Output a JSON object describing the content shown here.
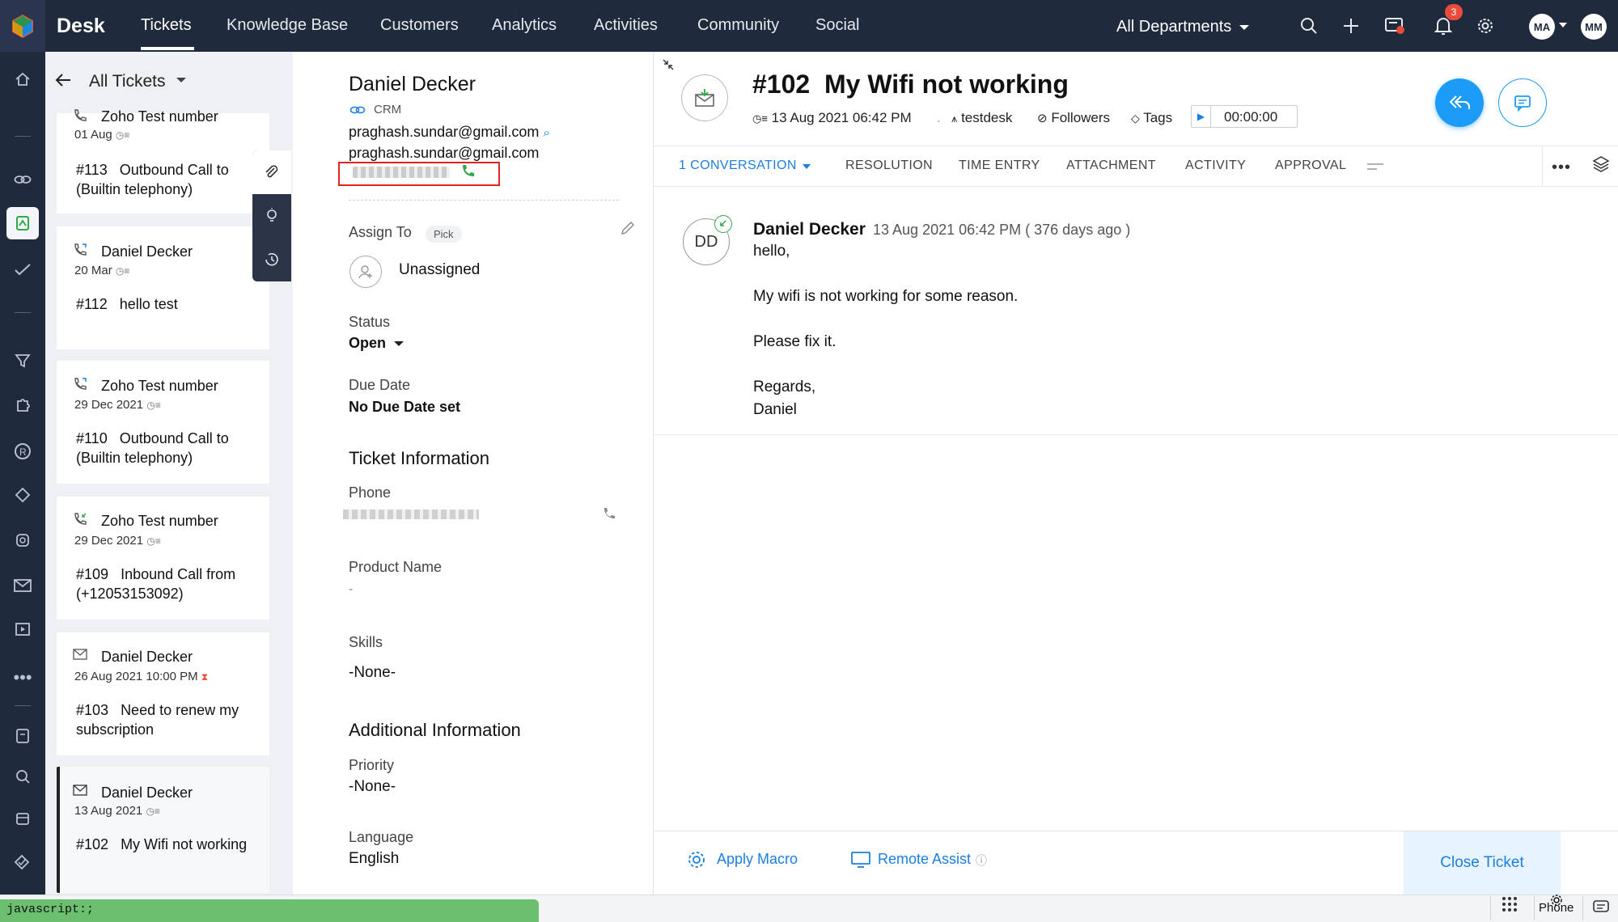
{
  "app": {
    "brand": "Desk"
  },
  "nav": {
    "items": [
      "Tickets",
      "Knowledge Base",
      "Customers",
      "Analytics",
      "Activities",
      "Community",
      "Social"
    ],
    "department": "All Departments",
    "notification_count": "3",
    "avatar1": "MA",
    "avatar2": "MM"
  },
  "list": {
    "title": "All Tickets",
    "cards": [
      {
        "name": "Zoho Test number",
        "date": "01 Aug",
        "number": "#113",
        "subject": "Outbound Call to (Builtin telephony)"
      },
      {
        "name": "Daniel Decker",
        "date": "20 Mar",
        "number": "#112",
        "subject": "hello test"
      },
      {
        "name": "Zoho Test number",
        "date": "29 Dec 2021",
        "number": "#110",
        "subject": "Outbound Call to (Builtin telephony)"
      },
      {
        "name": "Zoho Test number",
        "date": "29 Dec 2021",
        "number": "#109",
        "subject": "Inbound Call from (+12053153092)"
      },
      {
        "name": "Daniel Decker",
        "date": "26 Aug 2021 10:00 PM",
        "number": "#103",
        "subject": "Need to renew my subscription"
      },
      {
        "name": "Daniel Decker",
        "date": "13 Aug 2021",
        "number": "#102",
        "subject": "My Wifi not working"
      }
    ]
  },
  "contact": {
    "name": "Daniel Decker",
    "source": "CRM",
    "email1": "praghash.sundar@gmail.com",
    "email2": "praghash.sundar@gmail.com",
    "assign_label": "Assign To",
    "pick": "Pick",
    "assignee": "Unassigned",
    "status_label": "Status",
    "status": "Open",
    "due_label": "Due Date",
    "due": "No Due Date set",
    "ticket_info": "Ticket Information",
    "phone_label": "Phone",
    "product_label": "Product Name",
    "product": "-",
    "skills_label": "Skills",
    "skills": "-None-",
    "additional_info": "Additional Information",
    "priority_label": "Priority",
    "priority": "-None-",
    "language_label": "Language",
    "language": "English"
  },
  "ticket": {
    "number": "#102",
    "title": "My Wifi not working",
    "created": "13 Aug 2021 06:42 PM",
    "department": "testdesk",
    "followers": "Followers",
    "tags": "Tags",
    "timer": "00:00:00"
  },
  "tabs": [
    {
      "label": "1  CONVERSATION"
    },
    {
      "label": "RESOLUTION"
    },
    {
      "label": "TIME ENTRY"
    },
    {
      "label": "ATTACHMENT"
    },
    {
      "label": "ACTIVITY"
    },
    {
      "label": "APPROVAL"
    }
  ],
  "message": {
    "initials": "DD",
    "author": "Daniel Decker",
    "date": "13 Aug 2021 06:42 PM ( 376 days ago )",
    "lines": [
      "hello,",
      "My wifi is not working for some reason.",
      "Please fix it.",
      "Regards,",
      "Daniel"
    ]
  },
  "bottom": {
    "apply_macro": "Apply Macro",
    "remote_assist": "Remote Assist",
    "close_ticket": "Close Ticket"
  },
  "statusbar": {
    "link_hint": "javascript:;",
    "phone": "Phone"
  }
}
